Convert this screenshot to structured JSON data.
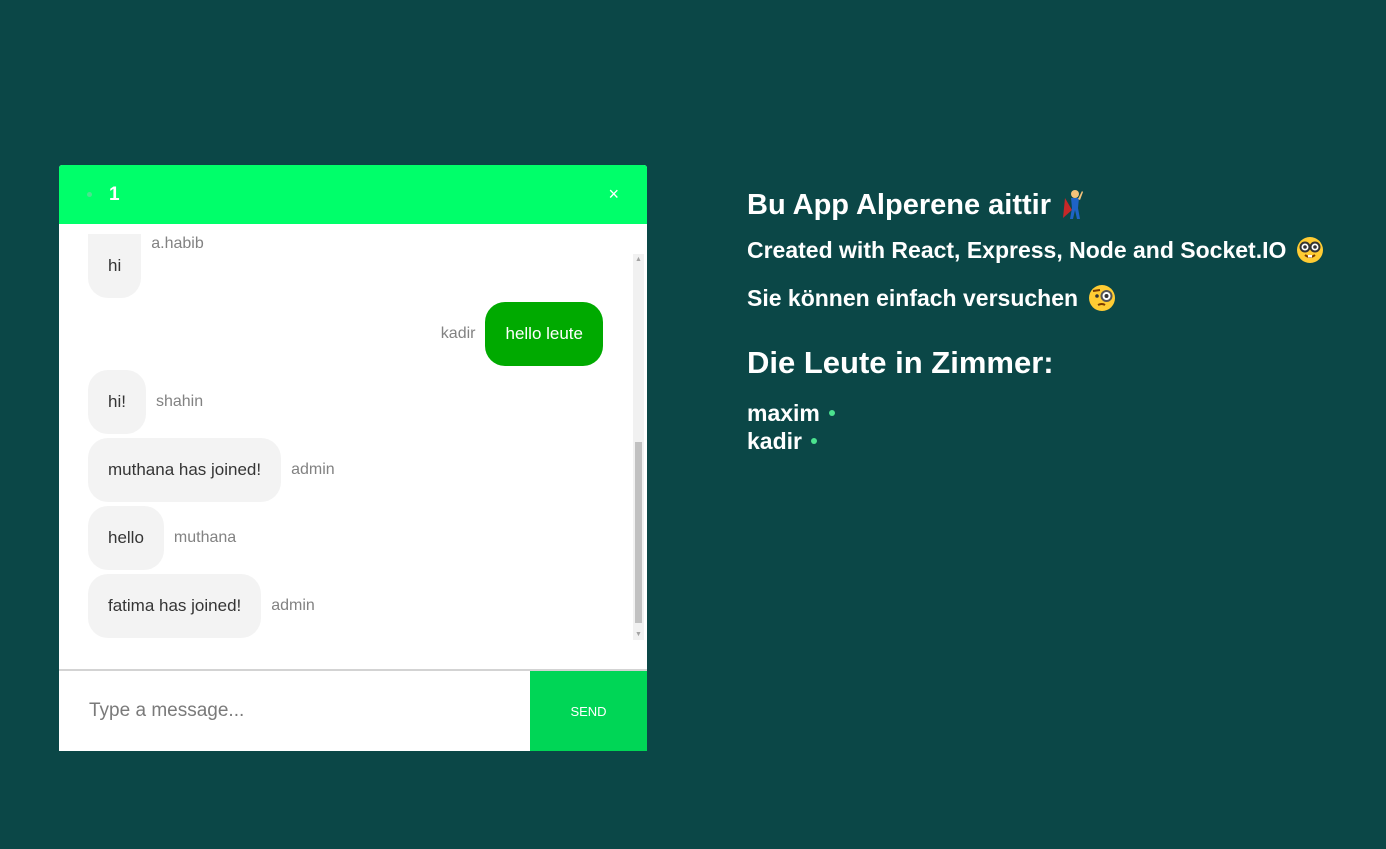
{
  "chat": {
    "room_name": "1",
    "close_glyph": "×",
    "messages": [
      {
        "text": "hi",
        "user": "a.habib",
        "side": "left"
      },
      {
        "text": "hello leute",
        "user": "kadir",
        "side": "right"
      },
      {
        "text": "hi!",
        "user": "shahin",
        "side": "left"
      },
      {
        "text": "muthana has joined!",
        "user": "admin",
        "side": "left"
      },
      {
        "text": "hello",
        "user": "muthana",
        "side": "left"
      },
      {
        "text": "fatima has joined!",
        "user": "admin",
        "side": "left"
      }
    ],
    "input": {
      "value": "",
      "placeholder": "Type a message..."
    },
    "send_label": "Send"
  },
  "info": {
    "title": "Bu App Alperene aittir",
    "line1": "Created with React, Express, Node and Socket.IO",
    "line2": "Sie können einfach versuchen",
    "people_title": "Die Leute in Zimmer:",
    "people": [
      "maxim",
      "kadir"
    ]
  },
  "colors": {
    "background": "#0b4747",
    "header": "#00ff6a",
    "my_bubble": "#00aa00",
    "other_bubble": "#f3f3f3",
    "send_button": "#00d656",
    "online": "#4be38f"
  },
  "icons": {
    "title_icon": "superhero-icon",
    "line1_icon": "nerd-face-icon",
    "line2_icon": "face-with-monocle-icon"
  }
}
